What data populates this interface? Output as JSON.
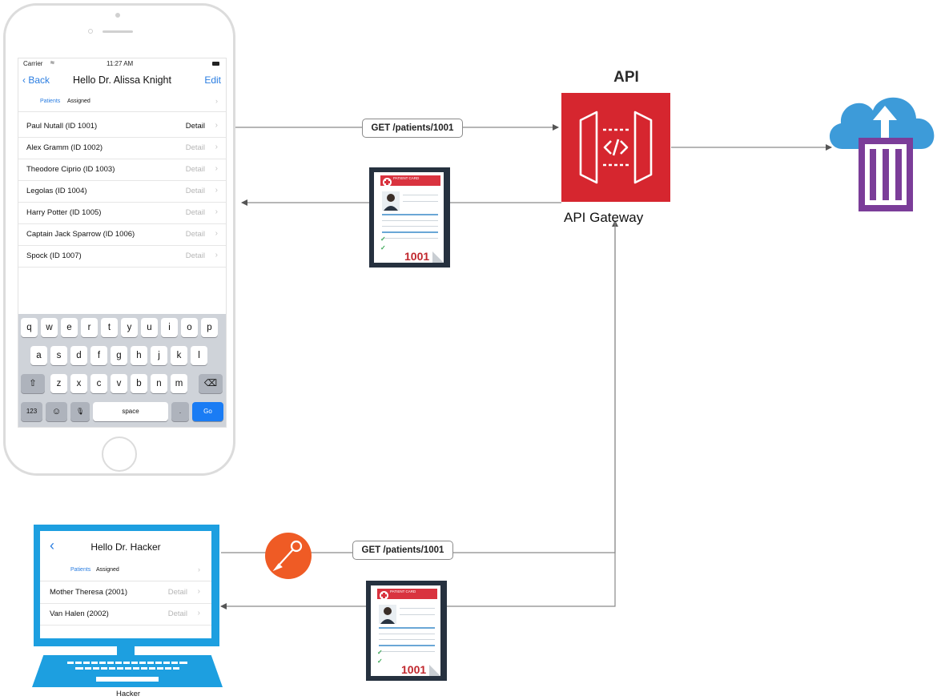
{
  "phone": {
    "status": {
      "carrier": "Carrier",
      "time": "11:27 AM"
    },
    "nav": {
      "back": "Back",
      "title": "Hello Dr. Alissa Knight",
      "edit": "Edit"
    },
    "subheader": {
      "patients": "Patients",
      "assigned": "Assigned"
    },
    "patients": [
      {
        "name": "Paul Nutall (ID 1001)",
        "detail": "Detail"
      },
      {
        "name": "Alex Gramm (ID 1002)",
        "detail": "Detail"
      },
      {
        "name": "Theodore Ciprio (ID 1003)",
        "detail": "Detail"
      },
      {
        "name": "Legolas (ID 1004)",
        "detail": "Detail"
      },
      {
        "name": "Harry Potter (ID 1005)",
        "detail": "Detail"
      },
      {
        "name": "Captain Jack Sparrow (ID 1006)",
        "detail": "Detail"
      },
      {
        "name": "Spock (ID 1007)",
        "detail": "Detail"
      }
    ],
    "keyboard": {
      "row1": [
        "q",
        "w",
        "e",
        "r",
        "t",
        "y",
        "u",
        "i",
        "o",
        "p"
      ],
      "row2": [
        "a",
        "s",
        "d",
        "f",
        "g",
        "h",
        "j",
        "k",
        "l"
      ],
      "row3": [
        "z",
        "x",
        "c",
        "v",
        "b",
        "n",
        "m"
      ],
      "shift": "⇧",
      "delete": "⌫",
      "numbers": "123",
      "emoji": "☺",
      "mic": "🎙",
      "space": "space",
      "period": ".",
      "go": "Go"
    }
  },
  "requests": {
    "top": "GET /patients/1001",
    "bottom": "GET /patients/1001"
  },
  "api": {
    "title": "API",
    "label": "API Gateway",
    "icon": "api-gateway-icon",
    "color": "#d6262f"
  },
  "cloud": {
    "icon": "cloud-container-icon",
    "cloud_color": "#3d9bd9",
    "container_color": "#7b3d99"
  },
  "postman": {
    "icon": "postman-icon",
    "color": "#ef5b25"
  },
  "card": {
    "header": "PATIENT CARD",
    "number": "1001"
  },
  "laptop": {
    "title": "Hello Dr. Hacker",
    "subheader": {
      "patients": "Patients",
      "assigned": "Assigned"
    },
    "patients": [
      {
        "name": "Mother Theresa (2001)",
        "detail": "Detail"
      },
      {
        "name": "Van Halen (2002)",
        "detail": "Detail"
      }
    ],
    "label": "Hacker",
    "color": "#1d9fe0"
  }
}
